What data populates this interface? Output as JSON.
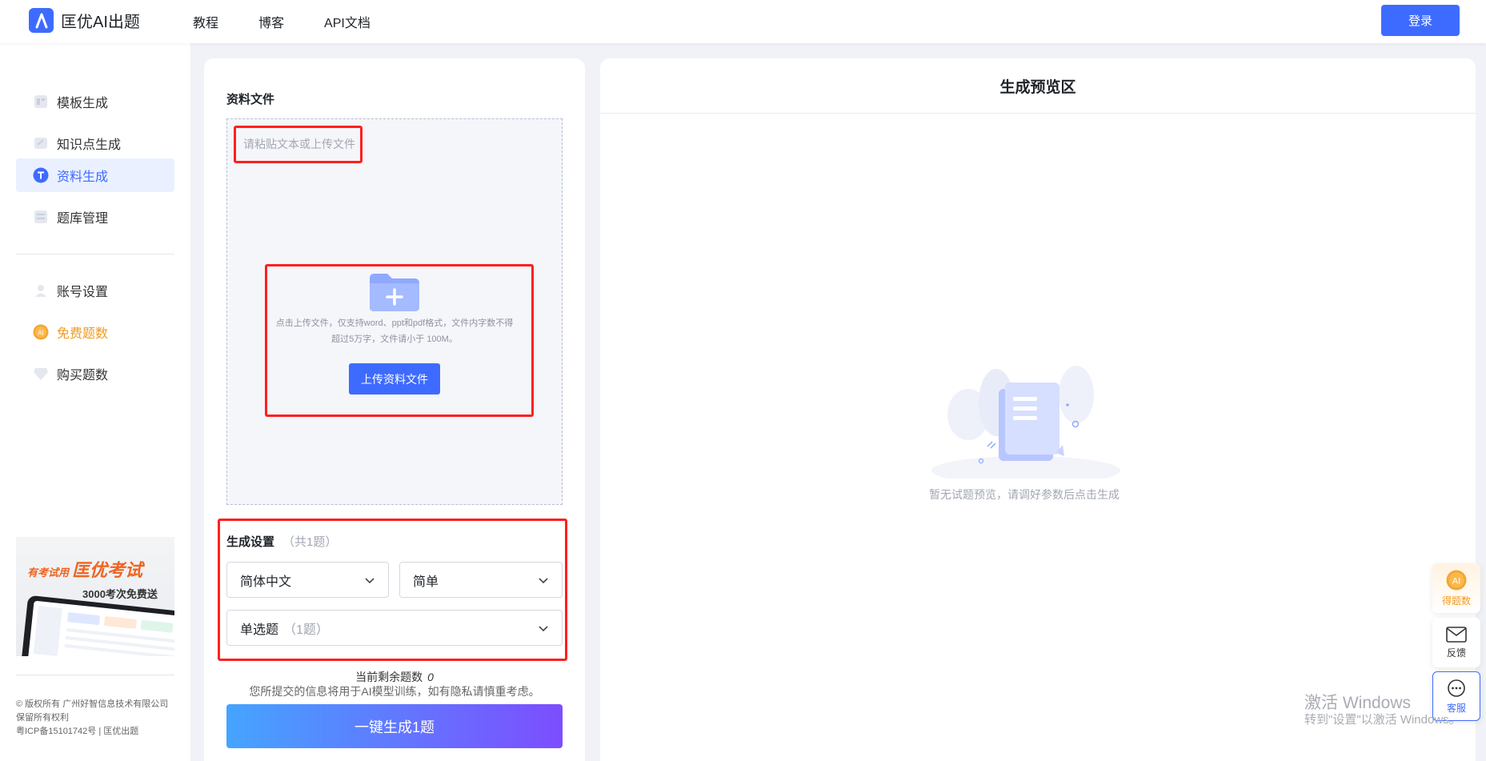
{
  "header": {
    "app_name": "匡优AI出题",
    "nav": [
      "教程",
      "博客",
      "API文档"
    ],
    "login_label": "登录"
  },
  "sidebar": {
    "items": [
      {
        "label": "模板生成",
        "icon": "template-icon"
      },
      {
        "label": "知识点生成",
        "icon": "knowledge-icon"
      },
      {
        "label": "资料生成",
        "icon": "document-t-icon",
        "active": true
      },
      {
        "label": "题库管理",
        "icon": "question-bank-icon"
      },
      {
        "label": "账号设置",
        "icon": "user-icon"
      },
      {
        "label": "免费题数",
        "icon": "ai-coin-icon",
        "highlight": "#f29a1f"
      },
      {
        "label": "购买题数",
        "icon": "diamond-icon"
      }
    ],
    "promo": {
      "small": "有考试用",
      "big": "匡优考试",
      "sub": "3000考次免费送"
    },
    "copyright": {
      "line1": "© 版权所有 广州好智信息技术有限公司",
      "line2": "保留所有权利",
      "line3": "粤ICP备15101742号 | 匡优出题"
    }
  },
  "left": {
    "file_title": "资料文件",
    "paste_placeholder": "请粘贴文本或上传文件",
    "upload_hint": "点击上传文件，仅支持word、ppt和pdf格式，文件内字数不得超过5万字，文件请小于 100M。",
    "upload_button": "上传资料文件",
    "settings_title": "生成设置",
    "settings_count": "（共1题）",
    "language": "简体中文",
    "difficulty": "简单",
    "question_type": "单选题",
    "question_type_count": "（1题）",
    "remaining_label": "当前剩余题数",
    "remaining_value": "0",
    "privacy_note": "您所提交的信息将用于AI模型训练，如有隐私请慎重考虑。",
    "generate_button": "一键生成1题"
  },
  "right": {
    "title": "生成预览区",
    "empty_text": "暂无试题预览，请调好参数后点击生成"
  },
  "floating": {
    "get_questions": "得题数",
    "feedback": "反馈",
    "support": "客服"
  },
  "watermark": {
    "line1": "激活 Windows",
    "line2": "转到\"设置\"以激活 Windows。"
  },
  "colors": {
    "primary": "#3e6bff",
    "accent_orange": "#f29a1f",
    "annotation_red": "#ff1f1f"
  }
}
